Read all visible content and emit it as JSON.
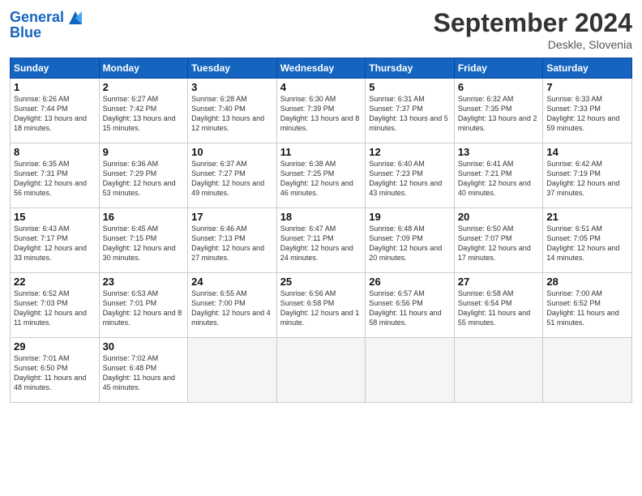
{
  "header": {
    "logo_line1": "General",
    "logo_line2": "Blue",
    "month": "September 2024",
    "location": "Deskle, Slovenia"
  },
  "days_of_week": [
    "Sunday",
    "Monday",
    "Tuesday",
    "Wednesday",
    "Thursday",
    "Friday",
    "Saturday"
  ],
  "weeks": [
    [
      {
        "day": "1",
        "sunrise": "Sunrise: 6:26 AM",
        "sunset": "Sunset: 7:44 PM",
        "daylight": "Daylight: 13 hours and 18 minutes."
      },
      {
        "day": "2",
        "sunrise": "Sunrise: 6:27 AM",
        "sunset": "Sunset: 7:42 PM",
        "daylight": "Daylight: 13 hours and 15 minutes."
      },
      {
        "day": "3",
        "sunrise": "Sunrise: 6:28 AM",
        "sunset": "Sunset: 7:40 PM",
        "daylight": "Daylight: 13 hours and 12 minutes."
      },
      {
        "day": "4",
        "sunrise": "Sunrise: 6:30 AM",
        "sunset": "Sunset: 7:39 PM",
        "daylight": "Daylight: 13 hours and 8 minutes."
      },
      {
        "day": "5",
        "sunrise": "Sunrise: 6:31 AM",
        "sunset": "Sunset: 7:37 PM",
        "daylight": "Daylight: 13 hours and 5 minutes."
      },
      {
        "day": "6",
        "sunrise": "Sunrise: 6:32 AM",
        "sunset": "Sunset: 7:35 PM",
        "daylight": "Daylight: 13 hours and 2 minutes."
      },
      {
        "day": "7",
        "sunrise": "Sunrise: 6:33 AM",
        "sunset": "Sunset: 7:33 PM",
        "daylight": "Daylight: 12 hours and 59 minutes."
      }
    ],
    [
      {
        "day": "8",
        "sunrise": "Sunrise: 6:35 AM",
        "sunset": "Sunset: 7:31 PM",
        "daylight": "Daylight: 12 hours and 56 minutes."
      },
      {
        "day": "9",
        "sunrise": "Sunrise: 6:36 AM",
        "sunset": "Sunset: 7:29 PM",
        "daylight": "Daylight: 12 hours and 53 minutes."
      },
      {
        "day": "10",
        "sunrise": "Sunrise: 6:37 AM",
        "sunset": "Sunset: 7:27 PM",
        "daylight": "Daylight: 12 hours and 49 minutes."
      },
      {
        "day": "11",
        "sunrise": "Sunrise: 6:38 AM",
        "sunset": "Sunset: 7:25 PM",
        "daylight": "Daylight: 12 hours and 46 minutes."
      },
      {
        "day": "12",
        "sunrise": "Sunrise: 6:40 AM",
        "sunset": "Sunset: 7:23 PM",
        "daylight": "Daylight: 12 hours and 43 minutes."
      },
      {
        "day": "13",
        "sunrise": "Sunrise: 6:41 AM",
        "sunset": "Sunset: 7:21 PM",
        "daylight": "Daylight: 12 hours and 40 minutes."
      },
      {
        "day": "14",
        "sunrise": "Sunrise: 6:42 AM",
        "sunset": "Sunset: 7:19 PM",
        "daylight": "Daylight: 12 hours and 37 minutes."
      }
    ],
    [
      {
        "day": "15",
        "sunrise": "Sunrise: 6:43 AM",
        "sunset": "Sunset: 7:17 PM",
        "daylight": "Daylight: 12 hours and 33 minutes."
      },
      {
        "day": "16",
        "sunrise": "Sunrise: 6:45 AM",
        "sunset": "Sunset: 7:15 PM",
        "daylight": "Daylight: 12 hours and 30 minutes."
      },
      {
        "day": "17",
        "sunrise": "Sunrise: 6:46 AM",
        "sunset": "Sunset: 7:13 PM",
        "daylight": "Daylight: 12 hours and 27 minutes."
      },
      {
        "day": "18",
        "sunrise": "Sunrise: 6:47 AM",
        "sunset": "Sunset: 7:11 PM",
        "daylight": "Daylight: 12 hours and 24 minutes."
      },
      {
        "day": "19",
        "sunrise": "Sunrise: 6:48 AM",
        "sunset": "Sunset: 7:09 PM",
        "daylight": "Daylight: 12 hours and 20 minutes."
      },
      {
        "day": "20",
        "sunrise": "Sunrise: 6:50 AM",
        "sunset": "Sunset: 7:07 PM",
        "daylight": "Daylight: 12 hours and 17 minutes."
      },
      {
        "day": "21",
        "sunrise": "Sunrise: 6:51 AM",
        "sunset": "Sunset: 7:05 PM",
        "daylight": "Daylight: 12 hours and 14 minutes."
      }
    ],
    [
      {
        "day": "22",
        "sunrise": "Sunrise: 6:52 AM",
        "sunset": "Sunset: 7:03 PM",
        "daylight": "Daylight: 12 hours and 11 minutes."
      },
      {
        "day": "23",
        "sunrise": "Sunrise: 6:53 AM",
        "sunset": "Sunset: 7:01 PM",
        "daylight": "Daylight: 12 hours and 8 minutes."
      },
      {
        "day": "24",
        "sunrise": "Sunrise: 6:55 AM",
        "sunset": "Sunset: 7:00 PM",
        "daylight": "Daylight: 12 hours and 4 minutes."
      },
      {
        "day": "25",
        "sunrise": "Sunrise: 6:56 AM",
        "sunset": "Sunset: 6:58 PM",
        "daylight": "Daylight: 12 hours and 1 minute."
      },
      {
        "day": "26",
        "sunrise": "Sunrise: 6:57 AM",
        "sunset": "Sunset: 6:56 PM",
        "daylight": "Daylight: 11 hours and 58 minutes."
      },
      {
        "day": "27",
        "sunrise": "Sunrise: 6:58 AM",
        "sunset": "Sunset: 6:54 PM",
        "daylight": "Daylight: 11 hours and 55 minutes."
      },
      {
        "day": "28",
        "sunrise": "Sunrise: 7:00 AM",
        "sunset": "Sunset: 6:52 PM",
        "daylight": "Daylight: 11 hours and 51 minutes."
      }
    ],
    [
      {
        "day": "29",
        "sunrise": "Sunrise: 7:01 AM",
        "sunset": "Sunset: 6:50 PM",
        "daylight": "Daylight: 11 hours and 48 minutes."
      },
      {
        "day": "30",
        "sunrise": "Sunrise: 7:02 AM",
        "sunset": "Sunset: 6:48 PM",
        "daylight": "Daylight: 11 hours and 45 minutes."
      },
      null,
      null,
      null,
      null,
      null
    ]
  ]
}
